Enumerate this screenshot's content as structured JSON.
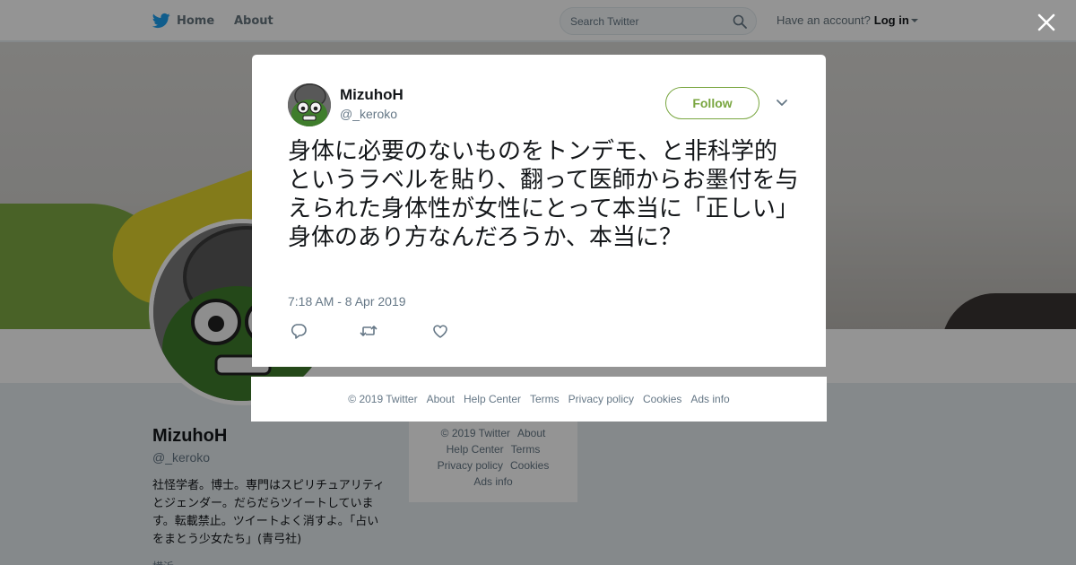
{
  "nav": {
    "home_label": "Home",
    "about_label": "About",
    "search_placeholder": "Search Twitter",
    "account_prompt": "Have an account?",
    "login_label": "Log in"
  },
  "profile": {
    "name": "MizuhoH",
    "handle": "@_keroko",
    "bio": "社怪学者。博士。専門はスピリチュアリティとジェンダー。だらだらツイートしています。転載禁止。ツイートよく消すよ。「占いをまとう少女たち」(青弓社)",
    "more": "横浜"
  },
  "sidebar_footer": {
    "row1": [
      "© 2019 Twitter",
      "About"
    ],
    "row2": [
      "Help Center",
      "Terms"
    ],
    "row3": [
      "Privacy policy",
      "Cookies"
    ],
    "row4": [
      "Ads info"
    ]
  },
  "tweet": {
    "author_name": "MizuhoH",
    "author_handle": "@_keroko",
    "follow_label": "Follow",
    "text": "身体に必要のないものをトンデモ、と非科学的というラベルを貼り、翻って医師からお墨付を与えられた身体性が女性にとって本当に「正しい」身体のあり方なんだろうか、本当に？",
    "timestamp": "7:18 AM - 8 Apr 2019",
    "actions": {
      "reply_icon": "reply-icon",
      "retweet_icon": "retweet-icon",
      "like_icon": "heart-icon"
    }
  },
  "modal_footer": {
    "copyright": "© 2019 Twitter",
    "about": "About",
    "help": "Help Center",
    "terms": "Terms",
    "privacy": "Privacy policy",
    "cookies": "Cookies",
    "ads": "Ads info"
  },
  "colors": {
    "twitter_blue": "#1da1f2",
    "follow_accent": "#79a640",
    "secondary_text": "#657786"
  }
}
